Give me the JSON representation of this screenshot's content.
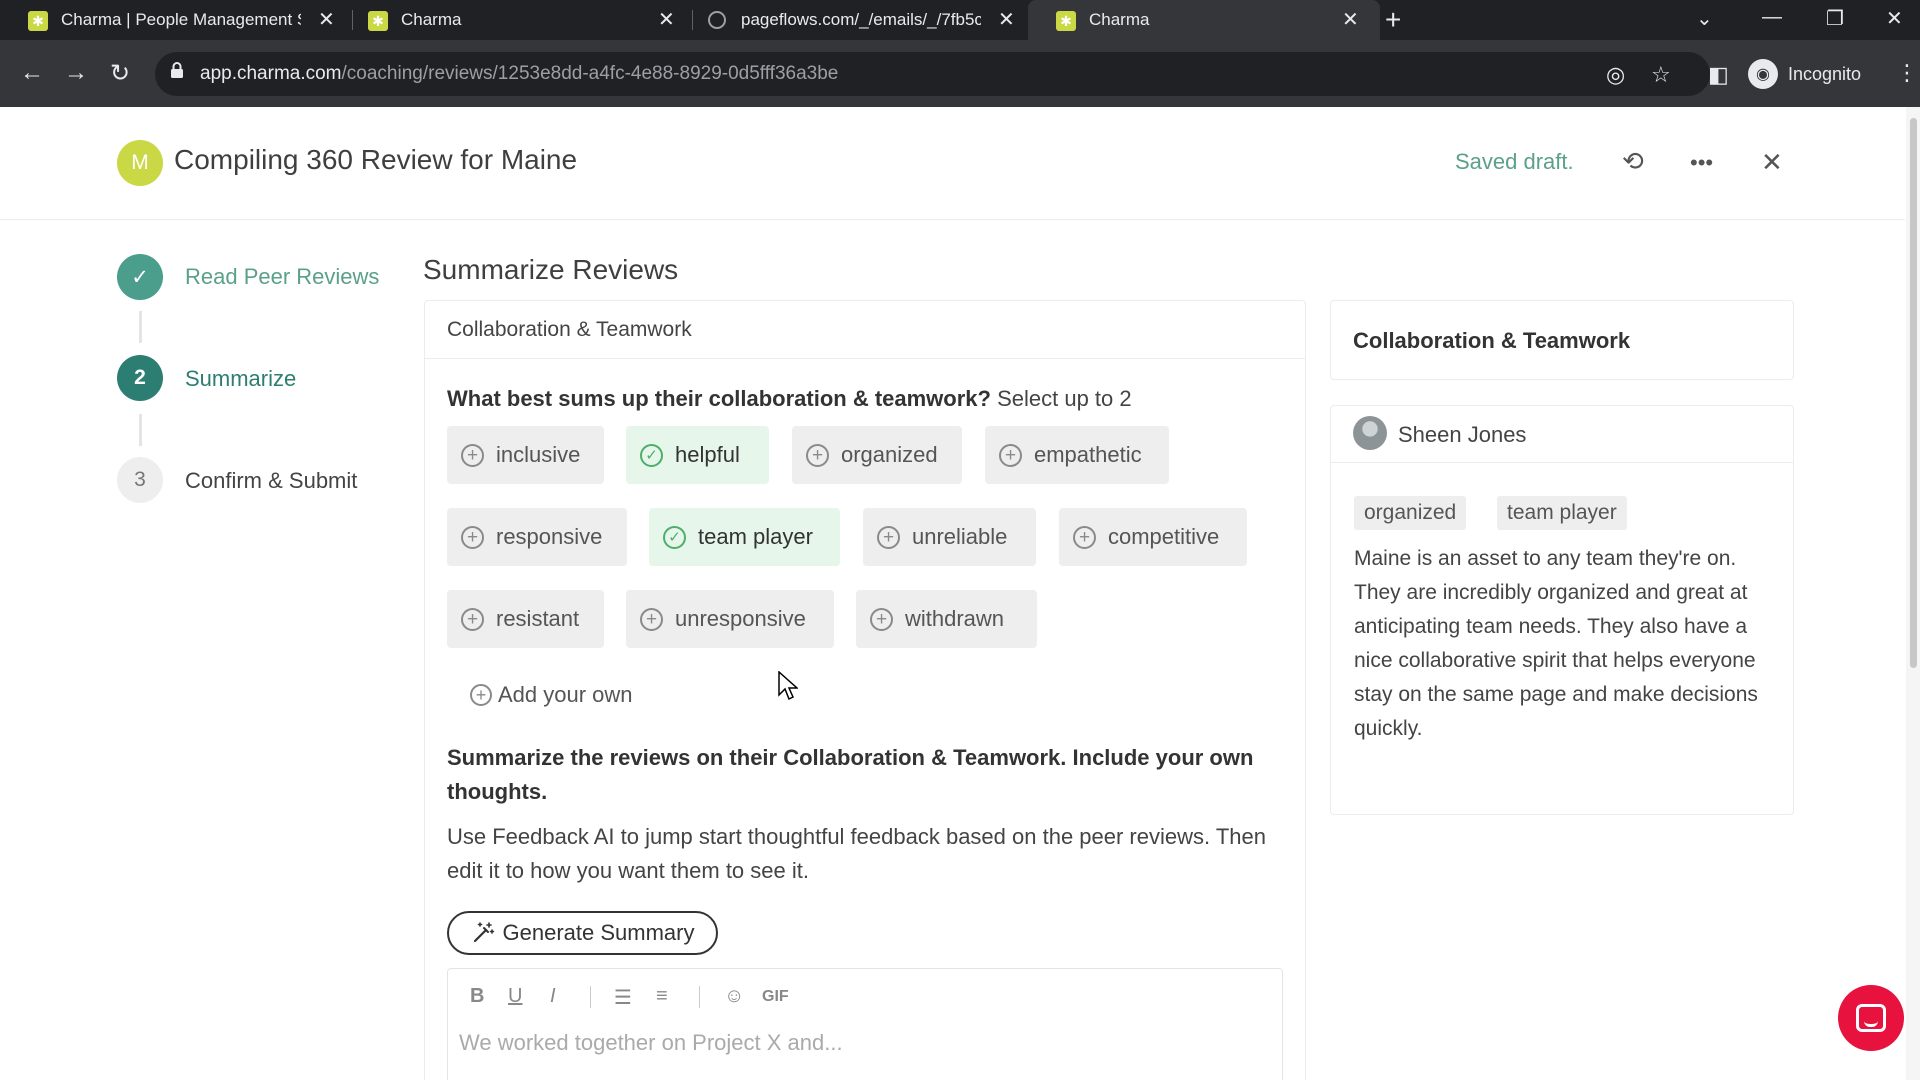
{
  "browser": {
    "tabs": [
      {
        "title": "Charma | People Management S",
        "active": false
      },
      {
        "title": "Charma",
        "active": false
      },
      {
        "title": "pageflows.com/_/emails/_/7fb5c",
        "active": false
      },
      {
        "title": "Charma",
        "active": true
      }
    ],
    "url_host": "app.charma.com",
    "url_path": "/coaching/reviews/1253e8dd-a4fc-4e88-8929-0d5fff36a3be",
    "profile_label": "Incognito"
  },
  "header": {
    "avatar_letter": "M",
    "title": "Compiling 360 Review for Maine",
    "status": "Saved draft."
  },
  "steps": [
    {
      "number": "✓",
      "label": "Read Peer Reviews",
      "state": "done"
    },
    {
      "number": "2",
      "label": "Summarize",
      "state": "current"
    },
    {
      "number": "3",
      "label": "Confirm & Submit",
      "state": "pending"
    }
  ],
  "main": {
    "section_title": "Summarize Reviews",
    "card_title": "Collaboration & Teamwork",
    "question": "What best sums up their collaboration & teamwork?",
    "question_hint": "Select up to 2",
    "chips": [
      {
        "label": "inclusive",
        "selected": false
      },
      {
        "label": "helpful",
        "selected": true
      },
      {
        "label": "organized",
        "selected": false
      },
      {
        "label": "empathetic",
        "selected": false
      },
      {
        "label": "responsive",
        "selected": false
      },
      {
        "label": "team player",
        "selected": true
      },
      {
        "label": "unreliable",
        "selected": false
      },
      {
        "label": "competitive",
        "selected": false
      },
      {
        "label": "resistant",
        "selected": false
      },
      {
        "label": "unresponsive",
        "selected": false
      },
      {
        "label": "withdrawn",
        "selected": false
      }
    ],
    "add_own_label": "Add your own",
    "prompt": "Summarize the reviews on their Collaboration & Teamwork. Include your own thoughts.",
    "description": "Use Feedback AI to jump start thoughtful feedback based on the peer reviews. Then edit it to how you want them to see it.",
    "generate_label": "Generate Summary",
    "editor_placeholder": "We worked together on Project X and...",
    "editor_tools": {
      "bold": "B",
      "underline": "U",
      "italic": "I",
      "gif": "GIF"
    }
  },
  "right_panel": {
    "title": "Collaboration & Teamwork",
    "reviewer_name": "Sheen Jones",
    "tags": [
      "organized",
      "team player"
    ],
    "review_text": "Maine is an asset to any team they're on. They are incredibly organized and great at anticipating team needs. They also have a nice collaborative spirit that helps everyone stay on the same page and make decisions quickly."
  },
  "colors": {
    "brand_green": "#c9d844",
    "teal": "#2c7e72",
    "saved_green": "#5aa08a",
    "selected_chip_bg": "#e6f6ea",
    "chat_red": "#e8123f"
  }
}
